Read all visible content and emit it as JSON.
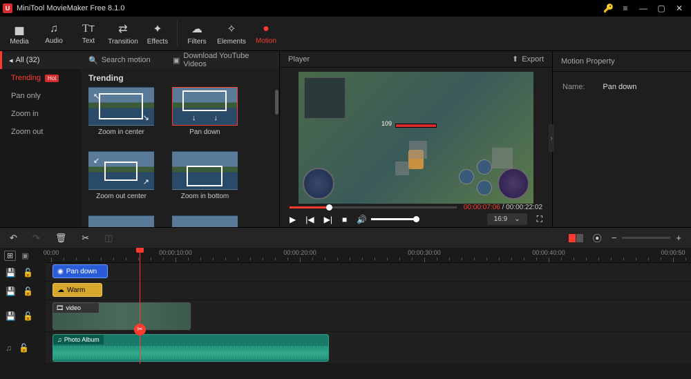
{
  "app": {
    "title": "MiniTool MovieMaker Free 8.1.0"
  },
  "toolbar": [
    {
      "id": "media",
      "label": "Media",
      "icon": "folder"
    },
    {
      "id": "audio",
      "label": "Audio",
      "icon": "music"
    },
    {
      "id": "text",
      "label": "Text",
      "icon": "text"
    },
    {
      "id": "transition",
      "label": "Transition",
      "icon": "swap"
    },
    {
      "id": "effects",
      "label": "Effects",
      "icon": "sparkle"
    },
    {
      "id": "filters",
      "label": "Filters",
      "icon": "cloud"
    },
    {
      "id": "elements",
      "label": "Elements",
      "icon": "star"
    },
    {
      "id": "motion",
      "label": "Motion",
      "icon": "dot",
      "active": true
    }
  ],
  "categories": {
    "all_label": "All (32)",
    "items": [
      {
        "label": "Trending",
        "hot": true,
        "active": true
      },
      {
        "label": "Pan only"
      },
      {
        "label": "Zoom in"
      },
      {
        "label": "Zoom out"
      }
    ]
  },
  "search": {
    "placeholder": "Search motion"
  },
  "youtube": {
    "label": "Download YouTube Videos"
  },
  "grid": {
    "title": "Trending",
    "items": [
      {
        "label": "Zoom in center"
      },
      {
        "label": "Pan down",
        "selected": true
      },
      {
        "label": "Zoom out center"
      },
      {
        "label": "Zoom in bottom"
      }
    ]
  },
  "player": {
    "title": "Player",
    "export": "Export",
    "current": "00:00:07:06",
    "duration": "00:00:22:02",
    "aspect": "16:9"
  },
  "props": {
    "title": "Motion Property",
    "name_label": "Name:",
    "name_value": "Pan down"
  },
  "timeline": {
    "labels": [
      "00:00",
      "00:00:10:00",
      "00:00:20:00",
      "00:00:30:00",
      "00:00:40:00",
      "00:00:50"
    ],
    "clips": {
      "motion": "Pan down",
      "filter": "Warm",
      "video": "video",
      "audio": "Photo Album"
    }
  }
}
